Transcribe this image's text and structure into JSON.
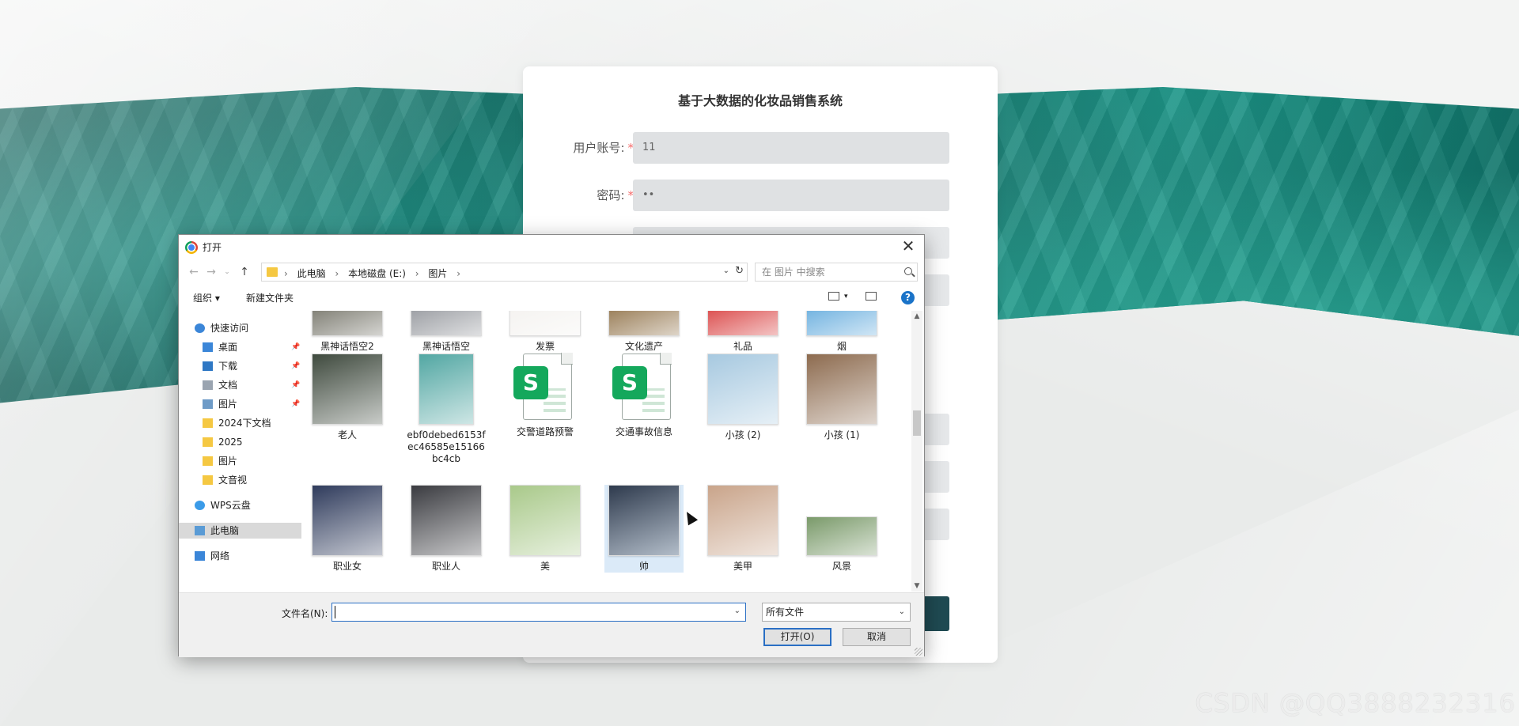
{
  "login": {
    "title": "基于大数据的化妆品销售系统",
    "fields": [
      {
        "label": "用户账号",
        "value": "11"
      },
      {
        "label": "密码",
        "value": "••"
      }
    ]
  },
  "watermark": "CSDN @QQ3888232316",
  "dialog": {
    "title": "打开",
    "breadcrumbs": [
      "此电脑",
      "本地磁盘 (E:)",
      "图片"
    ],
    "search_placeholder": "在 图片 中搜索",
    "toolbar": {
      "organize": "组织 ▾",
      "new_folder": "新建文件夹"
    },
    "sidebar": [
      {
        "label": "快速访问",
        "icon": "star-icon",
        "pinned": false
      },
      {
        "label": "桌面",
        "icon": "desktop-icon",
        "pinned": true
      },
      {
        "label": "下载",
        "icon": "download-icon",
        "pinned": true
      },
      {
        "label": "文档",
        "icon": "document-icon",
        "pinned": true
      },
      {
        "label": "图片",
        "icon": "picture-icon",
        "pinned": true
      },
      {
        "label": "2024下文档",
        "icon": "folder-icon",
        "pinned": false
      },
      {
        "label": "2025",
        "icon": "folder-icon",
        "pinned": false
      },
      {
        "label": "图片",
        "icon": "folder-icon",
        "pinned": false
      },
      {
        "label": "文音视",
        "icon": "folder-icon",
        "pinned": false
      },
      {
        "label": "WPS云盘",
        "icon": "cloud-icon",
        "pinned": false
      },
      {
        "label": "此电脑",
        "icon": "computer-icon",
        "pinned": false,
        "selected": true
      },
      {
        "label": "网络",
        "icon": "network-icon",
        "pinned": false
      }
    ],
    "files": [
      {
        "name": "黑神话悟空2",
        "kind": "image",
        "color": "#6b6a5e"
      },
      {
        "name": "黑神话悟空",
        "kind": "image",
        "color": "#8c8f95"
      },
      {
        "name": "发票",
        "kind": "image",
        "color": "#f3f1ee"
      },
      {
        "name": "文化遗产",
        "kind": "image",
        "color": "#8a6a3e"
      },
      {
        "name": "礼品",
        "kind": "image",
        "color": "#d63232"
      },
      {
        "name": "烟",
        "kind": "image",
        "color": "#5aa6db"
      },
      {
        "name": "老人",
        "kind": "image",
        "color": "#3f4a3e"
      },
      {
        "name": "ebf0debed6153fec46585e15166bc4cb",
        "kind": "image",
        "color": "#52a7a3"
      },
      {
        "name": "交警道路预警",
        "kind": "sheet"
      },
      {
        "name": "交通事故信息",
        "kind": "sheet"
      },
      {
        "name": "小孩 (2)",
        "kind": "image",
        "color": "#a7c9e0"
      },
      {
        "name": "小孩 (1)",
        "kind": "image",
        "color": "#8d6b4f"
      },
      {
        "name": "职业女",
        "kind": "image",
        "color": "#2f3b5c"
      },
      {
        "name": "职业人",
        "kind": "image",
        "color": "#3a3b40"
      },
      {
        "name": "美",
        "kind": "image",
        "color": "#a9c98a"
      },
      {
        "name": "帅",
        "kind": "image",
        "color": "#2e3a4d",
        "selected": true
      },
      {
        "name": "美甲",
        "kind": "image",
        "color": "#c9a48a"
      },
      {
        "name": "风景",
        "kind": "image",
        "color": "#7a9a6a"
      }
    ],
    "filename_label": "文件名(N):",
    "filename_value": "",
    "filetype": "所有文件",
    "open_button": "打开(O)",
    "cancel_button": "取消"
  }
}
